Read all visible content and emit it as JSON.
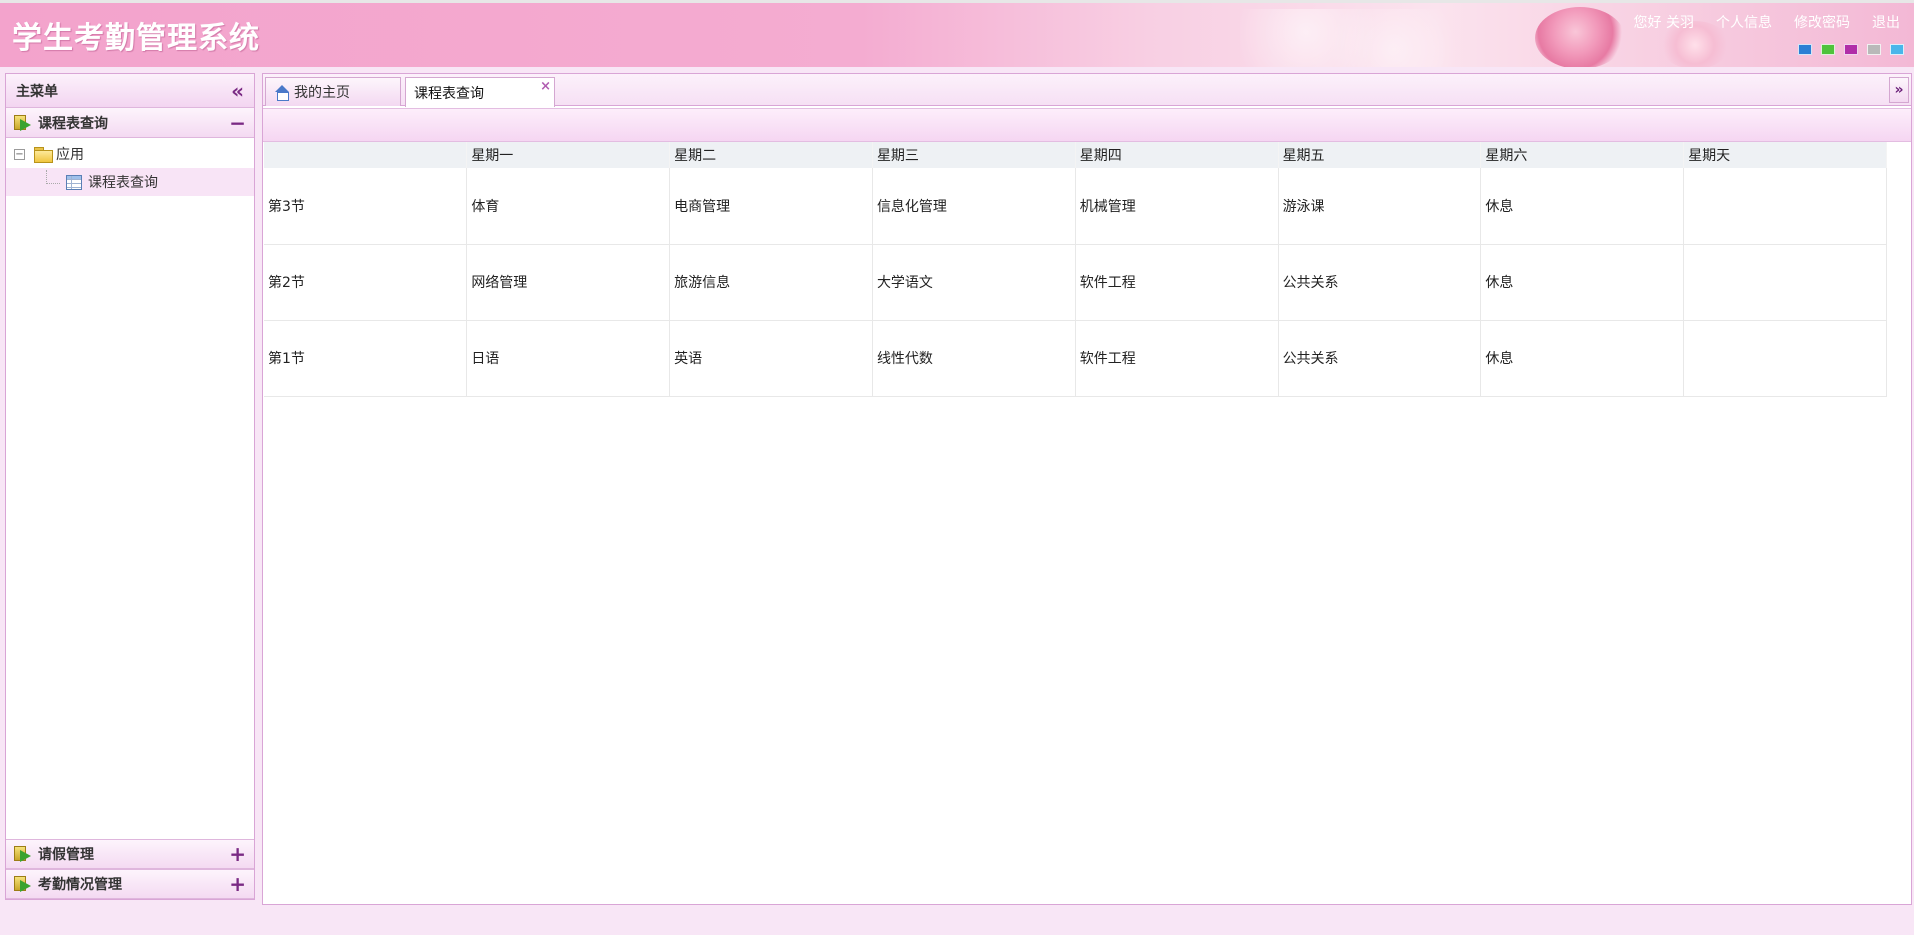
{
  "app": {
    "title": "学生考勤管理系统"
  },
  "topbar": {
    "greeting": "您好 关羽",
    "profile_link": "个人信息",
    "password_link": "修改密码",
    "logout_link": "退出",
    "theme_colors": [
      "#2b7fd4",
      "#4ec33b",
      "#b02ea8",
      "#b9b9b9",
      "#49b6ea"
    ]
  },
  "sidebar": {
    "title": "主菜单",
    "sections": [
      {
        "label": "课程表查询",
        "expanded": true,
        "toggle": "−",
        "tree": {
          "root_label": "应用",
          "children": [
            "课程表查询"
          ]
        }
      },
      {
        "label": "请假管理",
        "expanded": false,
        "toggle": "+"
      },
      {
        "label": "考勤情况管理",
        "expanded": false,
        "toggle": "+"
      }
    ]
  },
  "tabs": [
    {
      "label": "我的主页",
      "active": false,
      "icon": "home-icon"
    },
    {
      "label": "课程表查询",
      "active": true,
      "closable": true
    }
  ],
  "schedule": {
    "columns": [
      "",
      "星期一",
      "星期二",
      "星期三",
      "星期四",
      "星期五",
      "星期六",
      "星期天"
    ],
    "rows": [
      [
        "第3节",
        "体育",
        "电商管理",
        "信息化管理",
        "机械管理",
        "游泳课",
        "休息",
        ""
      ],
      [
        "第2节",
        "网络管理",
        "旅游信息",
        "大学语文",
        "软件工程",
        "公共关系",
        "休息",
        ""
      ],
      [
        "第1节",
        "日语",
        "英语",
        "线性代数",
        "软件工程",
        "公共关系",
        "休息",
        ""
      ]
    ]
  }
}
